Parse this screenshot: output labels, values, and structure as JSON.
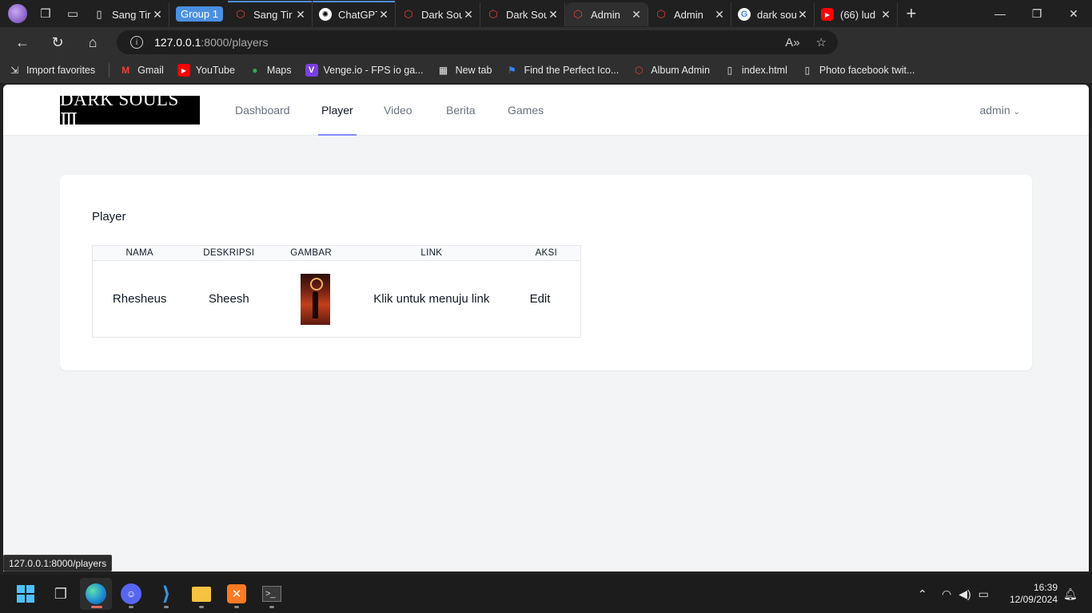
{
  "browser": {
    "tabs": [
      {
        "label": "Sang Tir",
        "icon": "page-icon"
      },
      {
        "label": "Sang Tir",
        "icon": "laravel-icon"
      },
      {
        "label": "ChatGPT",
        "icon": "chatgpt-icon"
      },
      {
        "label": "Dark Sou",
        "icon": "laravel-icon"
      },
      {
        "label": "Dark Sou",
        "icon": "laravel-icon"
      },
      {
        "label": "Admin",
        "icon": "laravel-icon"
      },
      {
        "label": "Admin",
        "icon": "laravel-icon"
      },
      {
        "label": "dark sou",
        "icon": "google-icon"
      },
      {
        "label": "(66) lud",
        "icon": "youtube-icon"
      }
    ],
    "group_label": "Group 1",
    "url_host": "127.0.0.1",
    "url_path": ":8000/players",
    "favorites": [
      {
        "label": "Import favorites"
      },
      {
        "label": "Gmail"
      },
      {
        "label": "YouTube"
      },
      {
        "label": "Maps"
      },
      {
        "label": "Venge.io - FPS io ga..."
      },
      {
        "label": "New tab"
      },
      {
        "label": "Find the Perfect Ico..."
      },
      {
        "label": "Album Admin"
      },
      {
        "label": "index.html"
      },
      {
        "label": "Photo facebook twit..."
      }
    ],
    "status_url": "127.0.0.1:8000/players"
  },
  "site": {
    "logo_text": "DARK SOULS Ⅲ",
    "nav": [
      {
        "label": "Dashboard"
      },
      {
        "label": "Player"
      },
      {
        "label": "Video"
      },
      {
        "label": "Berita"
      },
      {
        "label": "Games"
      }
    ],
    "user": "admin"
  },
  "card": {
    "title": "Player",
    "columns": [
      "NAMA",
      "DESKRIPSI",
      "GAMBAR",
      "LINK",
      "AKSI"
    ],
    "rows": [
      {
        "nama": "Rhesheus",
        "deskripsi": "Sheesh",
        "link": "Klik untuk menuju link",
        "aksi": "Edit"
      }
    ]
  },
  "taskbar": {
    "time": "16:39",
    "date": "12/09/2024"
  }
}
